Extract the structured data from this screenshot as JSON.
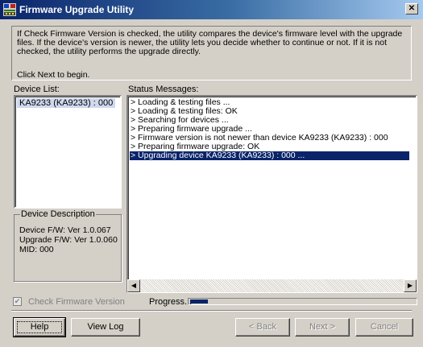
{
  "window": {
    "title": "Firmware Upgrade Utility",
    "close_icon": "close-icon",
    "app_icon": "firmware-utility-icon"
  },
  "info": {
    "text": "If Check Firmware Version is checked, the utility compares the device's firmware level with the upgrade files. If the device's version is newer, the utility lets you decide whether to continue or not. If it is not checked, the utility performs the upgrade directly.",
    "hint": "Click Next to begin."
  },
  "device_list": {
    "label": "Device List:",
    "items": [
      "KA9233 (KA9233) : 000"
    ],
    "selected_index": 0
  },
  "device_description": {
    "title": "Device Description",
    "device_fw": "Device F/W: Ver 1.0.067",
    "upgrade_fw": "Upgrade F/W: Ver 1.0.060",
    "mid": "MID: 000"
  },
  "status": {
    "label": "Status Messages:",
    "messages": [
      "> Loading & testing files ...",
      "> Loading & testing files: OK",
      "> Searching for devices ...",
      "> Preparing firmware upgrade ...",
      "> Firmware version is not newer than device KA9233 (KA9233) : 000",
      "> Preparing firmware upgrade: OK",
      "> Upgrading device KA9233 (KA9233) : 000 ..."
    ],
    "selected_index": 6
  },
  "check_firmware": {
    "label": "Check Firmware Version",
    "checked": true,
    "enabled": false
  },
  "progress": {
    "label": "Progress...",
    "value_percent": 8
  },
  "buttons": {
    "help": "Help",
    "view_log": "View Log",
    "back": "< Back",
    "next": "Next >",
    "cancel": "Cancel"
  },
  "colors": {
    "titlebar_start": "#0a246a",
    "selection": "#0a246a",
    "face": "#d4d0c8"
  }
}
